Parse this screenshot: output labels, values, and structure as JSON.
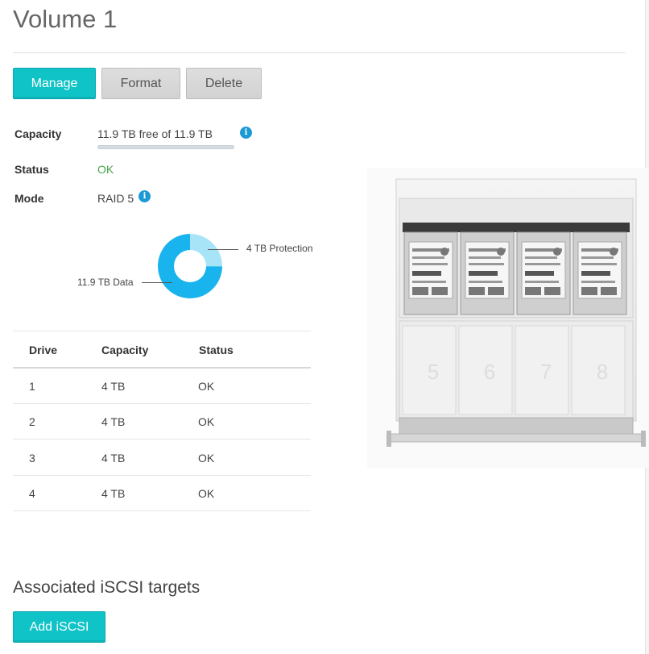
{
  "page": {
    "title": "Volume 1"
  },
  "toolbar": {
    "manage_label": "Manage",
    "format_label": "Format",
    "delete_label": "Delete"
  },
  "properties": {
    "capacity": {
      "label": "Capacity",
      "value": "11.9 TB free of 11.9 TB",
      "used_fraction": 0
    },
    "status": {
      "label": "Status",
      "value": "OK"
    },
    "mode": {
      "label": "Mode",
      "value": "RAID 5"
    }
  },
  "chart_data": {
    "type": "pie",
    "style": "donut",
    "slices": [
      {
        "label": "4 TB Protection",
        "value": 4,
        "color": "#a8e4f8"
      },
      {
        "label": "11.9 TB Data",
        "value": 11.9,
        "color": "#19b4ee"
      }
    ]
  },
  "drives_table": {
    "headers": {
      "drive": "Drive",
      "capacity": "Capacity",
      "status": "Status"
    },
    "rows": [
      {
        "drive": "1",
        "capacity": "4 TB",
        "status": "OK"
      },
      {
        "drive": "2",
        "capacity": "4 TB",
        "status": "OK"
      },
      {
        "drive": "3",
        "capacity": "4 TB",
        "status": "OK"
      },
      {
        "drive": "4",
        "capacity": "4 TB",
        "status": "OK"
      }
    ]
  },
  "enclosure": {
    "empty_bays": [
      "5",
      "6",
      "7",
      "8"
    ],
    "occupied_bays": 4
  },
  "iscsi": {
    "section_title": "Associated iSCSI targets",
    "add_label": "Add iSCSI"
  },
  "colors": {
    "accent": "#0fc3c7",
    "ok": "#4aa64a",
    "info": "#1b9ad6",
    "protection": "#a8e4f8",
    "data": "#19b4ee"
  }
}
